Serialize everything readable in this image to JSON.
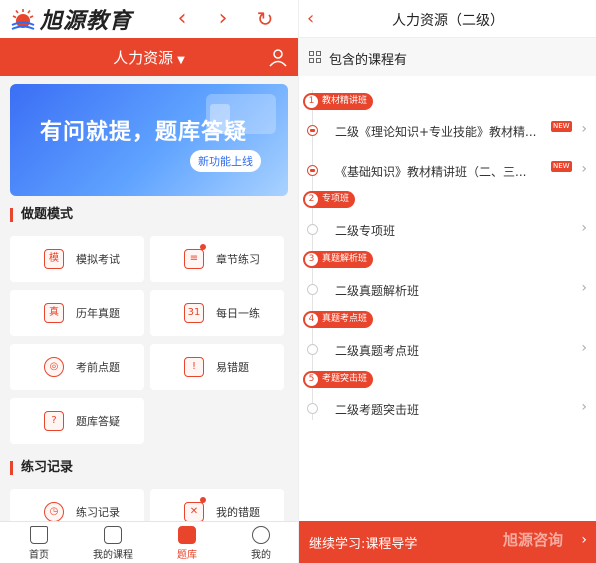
{
  "left": {
    "logo_text": "旭源教育",
    "back_icon": "chevron-left-icon",
    "forward_icon": "chevron-right-icon",
    "refresh_icon": "refresh-icon",
    "subject_selector": "人力资源",
    "user_icon": "user-icon",
    "banner": {
      "headline": "有问就提，题库答疑",
      "pill": "新功能上线"
    },
    "practice_mode_heading": "做题模式",
    "practice_modes": [
      {
        "label": "模拟考试",
        "icon": "mock-exam-icon",
        "glyph": "模",
        "dot": false
      },
      {
        "label": "章节练习",
        "icon": "chapter-icon",
        "glyph": "≡",
        "dot": true
      },
      {
        "label": "历年真题",
        "icon": "past-papers-icon",
        "glyph": "真",
        "dot": false
      },
      {
        "label": "每日一练",
        "icon": "calendar-icon",
        "glyph": "31",
        "dot": false
      },
      {
        "label": "考前点题",
        "icon": "target-icon",
        "glyph": "◎",
        "dot": false
      },
      {
        "label": "易错题",
        "icon": "alarm-icon",
        "glyph": "!",
        "dot": false
      },
      {
        "label": "题库答疑",
        "icon": "qa-icon",
        "glyph": "?",
        "dot": false
      }
    ],
    "records_heading": "练习记录",
    "records": [
      {
        "label": "练习记录",
        "icon": "history-icon",
        "glyph": "◷",
        "dot": false
      },
      {
        "label": "我的错题",
        "icon": "wrong-questions-icon",
        "glyph": "✕",
        "dot": true
      }
    ],
    "tabs": [
      {
        "label": "首页",
        "icon": "home-icon"
      },
      {
        "label": "我的课程",
        "icon": "course-icon"
      },
      {
        "label": "题库",
        "icon": "question-bank-icon"
      },
      {
        "label": "我的",
        "icon": "profile-icon"
      }
    ]
  },
  "right": {
    "title": "人力资源（二级）",
    "back_icon": "chevron-left-icon",
    "includes_label": "包含的课程有",
    "includes_icon": "grid-icon",
    "groups": [
      {
        "num": "1",
        "label": "教材精讲班",
        "items": [
          {
            "text": "二级《理论知识+专业技能》教材精...",
            "new": "NEW",
            "filled": true
          },
          {
            "text": "《基础知识》教材精讲班（二、三...",
            "new": "NEW",
            "filled": true
          }
        ]
      },
      {
        "num": "2",
        "label": "专项班",
        "items": [
          {
            "text": "二级专项班",
            "new": "",
            "filled": false
          }
        ]
      },
      {
        "num": "3",
        "label": "真题解析班",
        "items": [
          {
            "text": "二级真题解析班",
            "new": "",
            "filled": false
          }
        ]
      },
      {
        "num": "4",
        "label": "真题考点班",
        "items": [
          {
            "text": "二级真题考点班",
            "new": "",
            "filled": false
          }
        ]
      },
      {
        "num": "5",
        "label": "考题突击班",
        "items": [
          {
            "text": "二级考题突击班",
            "new": "",
            "filled": false
          }
        ]
      }
    ],
    "continue_label": "继续学习:课程导学",
    "watermark": "旭源咨询"
  },
  "colors": {
    "accent": "#e8452c",
    "banner_blue": "#3b6ef5"
  }
}
